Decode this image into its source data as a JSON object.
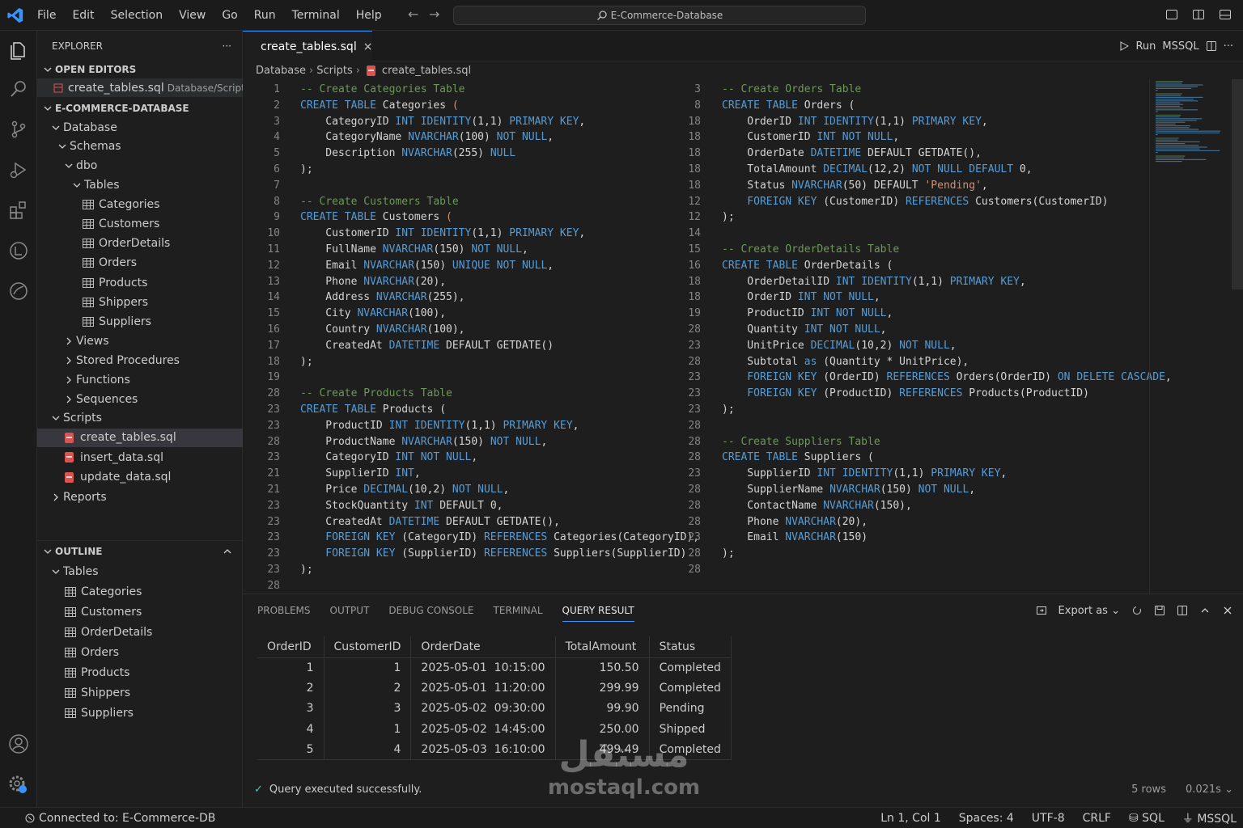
{
  "titlebar": {
    "menu": [
      "File",
      "Edit",
      "Selection",
      "View",
      "Go",
      "Run",
      "Terminal",
      "Help"
    ],
    "search_text": "E-Commerce-Database"
  },
  "sidebar": {
    "explorer_title": "EXPLORER",
    "open_editors_title": "OPEN EDITORS",
    "open_editor_file": "create_tables.sql",
    "open_editor_path": "Database/Scripts",
    "workspace_title": "E-COMMERCE-DATABASE",
    "tree": {
      "database": "Database",
      "schemas": "Schemas",
      "dbo": "dbo",
      "tables": "Tables",
      "table_items": [
        "Categories",
        "Customers",
        "OrderDetails",
        "Orders",
        "Products",
        "Shippers",
        "Suppliers"
      ],
      "collapsed_folders": [
        "Views",
        "Stored Procedures",
        "Functions",
        "Sequences"
      ],
      "scripts": "Scripts",
      "script_files": [
        "create_tables.sql",
        "insert_data.sql",
        "update_data.sql"
      ],
      "reports": "Reports"
    },
    "outline_title": "OUTLINE",
    "outline_tables": "Tables",
    "outline_items": [
      "Categories",
      "Customers",
      "OrderDetails",
      "Orders",
      "Products",
      "Shippers",
      "Suppliers"
    ]
  },
  "editor": {
    "tab_label": "create_tables.sql",
    "tab_close": "×",
    "run_label": "Run",
    "language": "MSSQL",
    "breadcrumb": [
      "Database",
      "Scripts",
      "create_tables.sql"
    ],
    "left_pane": [
      {
        "n": "1",
        "t": [
          [
            "cm",
            "-- Create Categories Table"
          ]
        ]
      },
      {
        "n": "2",
        "t": [
          [
            "kw",
            "CREATE TABLE "
          ],
          [
            "",
            "Categories "
          ],
          [
            "st",
            "("
          ]
        ]
      },
      {
        "n": "3",
        "t": [
          [
            "",
            "    CategoryID "
          ],
          [
            "kw",
            "INT IDENTITY"
          ],
          [
            "",
            "(1,1) "
          ],
          [
            "kw",
            "PRIMARY KEY"
          ],
          [
            "",
            ","
          ]
        ]
      },
      {
        "n": "4",
        "t": [
          [
            "",
            "    CategoryName "
          ],
          [
            "kw",
            "NVARCHAR"
          ],
          [
            "",
            "(100) "
          ],
          [
            "kw",
            "NOT NULL"
          ],
          [
            "",
            ","
          ]
        ]
      },
      {
        "n": "5",
        "t": [
          [
            "",
            "    Description "
          ],
          [
            "kw",
            "NVARCHAR"
          ],
          [
            "",
            "(255) "
          ],
          [
            "kw",
            "NULL"
          ]
        ]
      },
      {
        "n": "6",
        "t": [
          [
            "",
            ");"
          ]
        ]
      },
      {
        "n": "7",
        "t": [
          [
            "",
            ""
          ]
        ]
      },
      {
        "n": "8",
        "t": [
          [
            "cm",
            "-- Create Customers Table"
          ]
        ]
      },
      {
        "n": "9",
        "t": [
          [
            "kw",
            "CREATE TABLE "
          ],
          [
            "",
            "Customers "
          ],
          [
            "st",
            "("
          ]
        ]
      },
      {
        "n": "10",
        "t": [
          [
            "",
            "    CustomerID "
          ],
          [
            "kw",
            "INT IDENTITY"
          ],
          [
            "",
            "(1,1) "
          ],
          [
            "kw",
            "PRIMARY KEY"
          ],
          [
            "",
            ","
          ]
        ]
      },
      {
        "n": "11",
        "t": [
          [
            "",
            "    FullName "
          ],
          [
            "kw",
            "NVARCHAR"
          ],
          [
            "",
            "(150) "
          ],
          [
            "kw",
            "NOT NULL"
          ],
          [
            "",
            ","
          ]
        ]
      },
      {
        "n": "12",
        "t": [
          [
            "",
            "    Email "
          ],
          [
            "kw",
            "NVARCHAR"
          ],
          [
            "",
            "(150) "
          ],
          [
            "kw",
            "UNIQUE NOT NULL"
          ],
          [
            "",
            ","
          ]
        ]
      },
      {
        "n": "13",
        "t": [
          [
            "",
            "    Phone "
          ],
          [
            "kw",
            "NVARCHAR"
          ],
          [
            "",
            "(20),"
          ]
        ]
      },
      {
        "n": "14",
        "t": [
          [
            "",
            "    Address "
          ],
          [
            "kw",
            "NVARCHAR"
          ],
          [
            "",
            "(255),"
          ]
        ]
      },
      {
        "n": "15",
        "t": [
          [
            "",
            "    City "
          ],
          [
            "kw",
            "NVARCHAR"
          ],
          [
            "",
            "(100),"
          ]
        ]
      },
      {
        "n": "16",
        "t": [
          [
            "",
            "    Country "
          ],
          [
            "kw",
            "NVARCHAR"
          ],
          [
            "",
            "(100),"
          ]
        ]
      },
      {
        "n": "17",
        "t": [
          [
            "",
            "    CreatedAt "
          ],
          [
            "kw",
            "DATETIME"
          ],
          [
            "",
            " DEFAULT GETDATE()"
          ]
        ]
      },
      {
        "n": "18",
        "t": [
          [
            "",
            ");"
          ]
        ]
      },
      {
        "n": "19",
        "t": [
          [
            "",
            ""
          ]
        ]
      },
      {
        "n": "28",
        "t": [
          [
            "cm",
            "-- Create Products Table"
          ]
        ]
      },
      {
        "n": "23",
        "t": [
          [
            "kw",
            "CREATE TABLE "
          ],
          [
            "",
            "Products ("
          ]
        ]
      },
      {
        "n": "23",
        "t": [
          [
            "",
            "    ProductID "
          ],
          [
            "kw",
            "INT IDENTITY"
          ],
          [
            "",
            "(1,1) "
          ],
          [
            "kw",
            "PRIMARY KEY"
          ],
          [
            "",
            ","
          ]
        ]
      },
      {
        "n": "28",
        "t": [
          [
            "",
            "    ProductName "
          ],
          [
            "kw",
            "NVARCHAR"
          ],
          [
            "",
            "(150) "
          ],
          [
            "kw",
            "NOT NULL"
          ],
          [
            "",
            ","
          ]
        ]
      },
      {
        "n": "23",
        "t": [
          [
            "",
            "    CategoryID "
          ],
          [
            "kw",
            "INT NOT NULL"
          ],
          [
            "",
            ","
          ]
        ]
      },
      {
        "n": "21",
        "t": [
          [
            "",
            "    SupplierID "
          ],
          [
            "kw",
            "INT"
          ],
          [
            "",
            ","
          ]
        ]
      },
      {
        "n": "21",
        "t": [
          [
            "",
            "    Price "
          ],
          [
            "kw",
            "DECIMAL"
          ],
          [
            "",
            "(10,2) "
          ],
          [
            "kw",
            "NOT NULL"
          ],
          [
            "",
            ","
          ]
        ]
      },
      {
        "n": "23",
        "t": [
          [
            "",
            "    StockQuantity "
          ],
          [
            "kw",
            "INT"
          ],
          [
            "",
            " DEFAULT 0,"
          ]
        ]
      },
      {
        "n": "23",
        "t": [
          [
            "",
            "    CreatedAt "
          ],
          [
            "kw",
            "DATETIME"
          ],
          [
            "",
            " DEFAULT GETDATE(),"
          ]
        ]
      },
      {
        "n": "23",
        "t": [
          [
            "kw",
            "    FOREIGN KEY "
          ],
          [
            "",
            "(CategoryID) "
          ],
          [
            "kw",
            "REFERENCES "
          ],
          [
            "",
            "Categories(CategoryID),"
          ]
        ]
      },
      {
        "n": "23",
        "t": [
          [
            "kw",
            "    FOREIGN KEY "
          ],
          [
            "",
            "(SupplierID) "
          ],
          [
            "kw",
            "REFERENCES "
          ],
          [
            "",
            "Suppliers(SupplierID)"
          ]
        ]
      },
      {
        "n": "23",
        "t": [
          [
            "",
            ");"
          ]
        ]
      },
      {
        "n": "28",
        "t": [
          [
            "",
            ""
          ]
        ]
      }
    ],
    "right_pane": [
      {
        "n": "3",
        "t": [
          [
            "cm",
            "-- Create Orders Table"
          ]
        ]
      },
      {
        "n": "8",
        "t": [
          [
            "kw",
            "CREATE TABLE "
          ],
          [
            "",
            "Orders ("
          ]
        ]
      },
      {
        "n": "18",
        "t": [
          [
            "",
            "    OrderID "
          ],
          [
            "kw",
            "INT IDENTITY"
          ],
          [
            "",
            "(1,1) "
          ],
          [
            "kw",
            "PRIMARY KEY"
          ],
          [
            "",
            ","
          ]
        ]
      },
      {
        "n": "18",
        "t": [
          [
            "",
            "    CustomerID "
          ],
          [
            "kw",
            "INT NOT NULL"
          ],
          [
            "",
            ","
          ]
        ]
      },
      {
        "n": "18",
        "t": [
          [
            "",
            "    OrderDate "
          ],
          [
            "kw",
            "DATETIME"
          ],
          [
            "",
            " DEFAULT GETDATE(),"
          ]
        ]
      },
      {
        "n": "18",
        "t": [
          [
            "",
            "    TotalAmount "
          ],
          [
            "kw",
            "DECIMAL"
          ],
          [
            "",
            "(12,2) "
          ],
          [
            "kw",
            "NOT NULL DEFAULT"
          ],
          [
            "",
            " 0,"
          ]
        ]
      },
      {
        "n": "18",
        "t": [
          [
            "",
            "    Status "
          ],
          [
            "kw",
            "NVARCHAR"
          ],
          [
            "",
            "(50) DEFAULT "
          ],
          [
            "st",
            "'Pending'"
          ],
          [
            "",
            ","
          ]
        ]
      },
      {
        "n": "12",
        "t": [
          [
            "kw",
            "    FOREIGN KEY "
          ],
          [
            "",
            "(CustomerID) "
          ],
          [
            "kw",
            "REFERENCES "
          ],
          [
            "",
            "Customers(CustomerID)"
          ]
        ]
      },
      {
        "n": "12",
        "t": [
          [
            "",
            ");"
          ]
        ]
      },
      {
        "n": "14",
        "t": [
          [
            "",
            ""
          ]
        ]
      },
      {
        "n": "15",
        "t": [
          [
            "cm",
            "-- Create OrderDetails Table"
          ]
        ]
      },
      {
        "n": "16",
        "t": [
          [
            "kw",
            "CREATE TABLE "
          ],
          [
            "",
            "OrderDetails ("
          ]
        ]
      },
      {
        "n": "18",
        "t": [
          [
            "",
            "    OrderDetailID "
          ],
          [
            "kw",
            "INT IDENTITY"
          ],
          [
            "",
            "(1,1) "
          ],
          [
            "kw",
            "PRIMARY KEY"
          ],
          [
            "",
            ","
          ]
        ]
      },
      {
        "n": "18",
        "t": [
          [
            "",
            "    OrderID "
          ],
          [
            "kw",
            "INT NOT NULL"
          ],
          [
            "",
            ","
          ]
        ]
      },
      {
        "n": "19",
        "t": [
          [
            "",
            "    ProductID "
          ],
          [
            "kw",
            "INT NOT NULL"
          ],
          [
            "",
            ","
          ]
        ]
      },
      {
        "n": "28",
        "t": [
          [
            "",
            "    Quantity "
          ],
          [
            "kw",
            "INT NOT NULL"
          ],
          [
            "",
            ","
          ]
        ]
      },
      {
        "n": "23",
        "t": [
          [
            "",
            "    UnitPrice "
          ],
          [
            "kw",
            "DECIMAL"
          ],
          [
            "",
            "(10,2) "
          ],
          [
            "kw",
            "NOT NULL"
          ],
          [
            "",
            ","
          ]
        ]
      },
      {
        "n": "28",
        "t": [
          [
            "",
            "    Subtotal "
          ],
          [
            "kw",
            "as"
          ],
          [
            "",
            " (Quantity * UnitPrice),"
          ]
        ]
      },
      {
        "n": "23",
        "t": [
          [
            "kw",
            "    FOREIGN KEY "
          ],
          [
            "",
            "(OrderID) "
          ],
          [
            "kw",
            "REFERENCES "
          ],
          [
            "",
            "Orders(OrderID) "
          ],
          [
            "kw",
            "ON DELETE CASCADE"
          ],
          [
            "",
            ","
          ]
        ]
      },
      {
        "n": "23",
        "t": [
          [
            "kw",
            "    FOREIGN KEY "
          ],
          [
            "",
            "(ProductID) "
          ],
          [
            "kw",
            "REFERENCES "
          ],
          [
            "",
            "Products(ProductID)"
          ]
        ]
      },
      {
        "n": "23",
        "t": [
          [
            "",
            ");"
          ]
        ]
      },
      {
        "n": "28",
        "t": [
          [
            "",
            ""
          ]
        ]
      },
      {
        "n": "28",
        "t": [
          [
            "cm",
            "-- Create Suppliers Table"
          ]
        ]
      },
      {
        "n": "28",
        "t": [
          [
            "kw",
            "CREATE TABLE "
          ],
          [
            "",
            "Suppliers ("
          ]
        ]
      },
      {
        "n": "23",
        "t": [
          [
            "",
            "    SupplierID "
          ],
          [
            "kw",
            "INT IDENTITY"
          ],
          [
            "",
            "(1,1) "
          ],
          [
            "kw",
            "PRIMARY KEY"
          ],
          [
            "",
            ","
          ]
        ]
      },
      {
        "n": "28",
        "t": [
          [
            "",
            "    SupplierName "
          ],
          [
            "kw",
            "NVARCHAR"
          ],
          [
            "",
            "(150) "
          ],
          [
            "kw",
            "NOT NULL"
          ],
          [
            "",
            ","
          ]
        ]
      },
      {
        "n": "28",
        "t": [
          [
            "",
            "    ContactName "
          ],
          [
            "kw",
            "NVARCHAR"
          ],
          [
            "",
            "(150),"
          ]
        ]
      },
      {
        "n": "28",
        "t": [
          [
            "",
            "    Phone "
          ],
          [
            "kw",
            "NVARCHAR"
          ],
          [
            "",
            "(20),"
          ]
        ]
      },
      {
        "n": "23",
        "t": [
          [
            "",
            "    Email "
          ],
          [
            "kw",
            "NVARCHAR"
          ],
          [
            "",
            "(150)"
          ]
        ]
      },
      {
        "n": "28",
        "t": [
          [
            "",
            ");"
          ]
        ]
      },
      {
        "n": "28",
        "t": [
          [
            "",
            ""
          ]
        ]
      }
    ]
  },
  "panel": {
    "tabs": [
      "PROBLEMS",
      "OUTPUT",
      "DEBUG CONSOLE",
      "TERMINAL",
      "QUERY RESULT"
    ],
    "active_tab": "QUERY RESULT",
    "export_label": "Export as",
    "columns": [
      "OrderID",
      "CustomerID",
      "OrderDate",
      "TotalAmount",
      "Status"
    ],
    "rows": [
      [
        "1",
        "1",
        "2025-05-01  10:15:00",
        "150.50",
        "Completed"
      ],
      [
        "2",
        "2",
        "2025-05-01  11:20:00",
        "299.99",
        "Completed"
      ],
      [
        "3",
        "3",
        "2025-05-02  09:30:00",
        "99.90",
        "Pending"
      ],
      [
        "4",
        "1",
        "2025-05-02  14:45:00",
        "250.00",
        "Shipped"
      ],
      [
        "5",
        "4",
        "2025-05-03  16:10:00",
        "499.49",
        "Completed"
      ]
    ],
    "status_message": "Query executed successfully.",
    "row_count": "5 rows",
    "duration": "0.021s"
  },
  "statusbar": {
    "connection": "Connected to: E-Commerce-DB",
    "position": "Ln 1, Col 1",
    "spaces": "Spaces: 4",
    "encoding": "UTF-8",
    "eol": "CRLF",
    "language": "SQL",
    "provider": "MSSQL"
  },
  "watermark": {
    "arabic": "مستقل",
    "latin": "mostaql.com"
  },
  "colors": {
    "accent": "#3794ff",
    "keyword": "#569cd6",
    "comment": "#6a9955",
    "string": "#ce9178",
    "sql_file": "#d9534f"
  }
}
